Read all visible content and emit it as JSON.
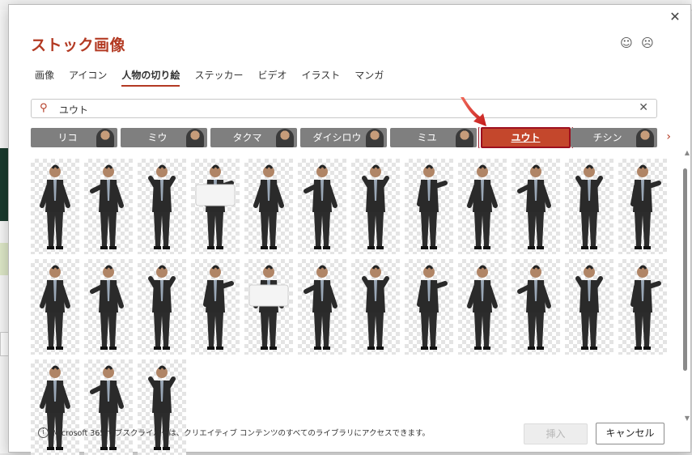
{
  "dialog": {
    "title": "ストック画像",
    "close_icon": "close-icon",
    "feedback": {
      "smile_icon": "☺",
      "frown_icon": "☹"
    }
  },
  "tabs": [
    {
      "label": "画像"
    },
    {
      "label": "アイコン"
    },
    {
      "label": "人物の切り絵",
      "active": true
    },
    {
      "label": "ステッカー"
    },
    {
      "label": "ビデオ"
    },
    {
      "label": "イラスト"
    },
    {
      "label": "マンガ"
    }
  ],
  "search": {
    "value": "ユウト",
    "icon": "search-icon",
    "clear_icon": "✕"
  },
  "persons": [
    {
      "label": "リコ"
    },
    {
      "label": "ミウ"
    },
    {
      "label": "タクマ"
    },
    {
      "label": "ダイシロウ"
    },
    {
      "label": "ミユ"
    },
    {
      "label": "ユウト",
      "active": true
    },
    {
      "label": "チシン"
    }
  ],
  "results_count": 27,
  "footer": {
    "info_text": "Microsoft 365 サブスクライバーは、クリエイティブ コンテンツのすべてのライブラリにアクセスできます。",
    "insert_label": "挿入",
    "cancel_label": "キャンセル"
  },
  "colors": {
    "accent": "#b33a23",
    "selected_chip": "#c4472c",
    "chip": "#7f7f7f"
  }
}
